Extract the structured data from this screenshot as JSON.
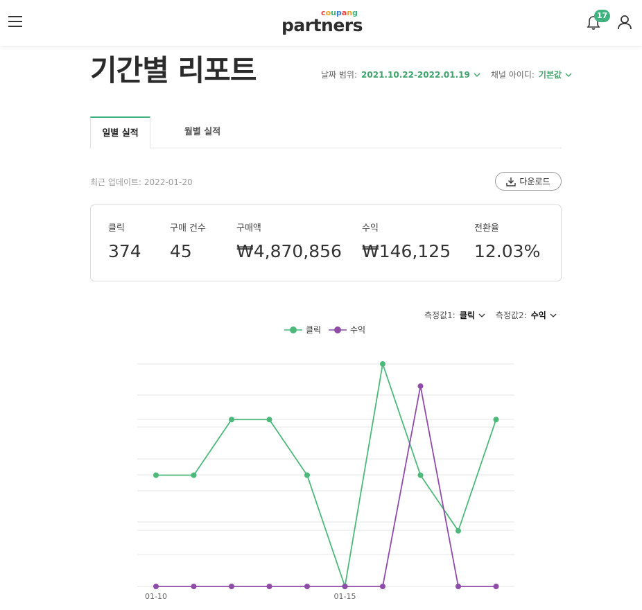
{
  "header": {
    "logo_top": "coupang",
    "logo_main": "partners",
    "notification_count": "17"
  },
  "page": {
    "title": "기간별 리포트"
  },
  "filters": {
    "date_range_label": "날짜 범위:",
    "date_range_value": "2021.10.22-2022.01.19",
    "channel_label": "채널 아이디:",
    "channel_value": "기본값"
  },
  "tabs": [
    {
      "label": "일별 실적",
      "active": true
    },
    {
      "label": "월별 실적",
      "active": false
    }
  ],
  "updated": "최근 업데이트: 2022-01-20",
  "download_label": "다운로드",
  "summary": [
    {
      "label": "클릭",
      "value": "374"
    },
    {
      "label": "구매 건수",
      "value": "45"
    },
    {
      "label": "구매액",
      "value": "₩4,870,856"
    },
    {
      "label": "수익",
      "value": "₩146,125"
    },
    {
      "label": "전환율",
      "value": "12.03%"
    }
  ],
  "measures": {
    "m1_label": "측정값1:",
    "m1_value": "클릭",
    "m2_label": "측정값2:",
    "m2_value": "수익"
  },
  "colors": {
    "accent_green": "#3fb27f",
    "series_click": "#4cb87a",
    "series_revenue": "#8e4ba8",
    "logo_c": "#e8423d",
    "logo_o": "#f0a020",
    "logo_u": "#3fb27f",
    "logo_p": "#2f7fd0"
  },
  "chart_data": {
    "type": "line",
    "x": [
      "01-10",
      "01-11",
      "01-12",
      "01-13",
      "01-14",
      "01-15",
      "01-16",
      "01-17",
      "01-18",
      "01-19"
    ],
    "x_tick_labels": [
      "01-10",
      "01-15"
    ],
    "series": [
      {
        "name": "클릭",
        "values": [
          20,
          20,
          30,
          30,
          20,
          0,
          40,
          20,
          10,
          30
        ]
      },
      {
        "name": "수익",
        "values": [
          0,
          0,
          0,
          0,
          0,
          0,
          0,
          36,
          0,
          0
        ]
      }
    ],
    "ylim": [
      0,
      40
    ],
    "legend": "top-center",
    "grid": true
  }
}
